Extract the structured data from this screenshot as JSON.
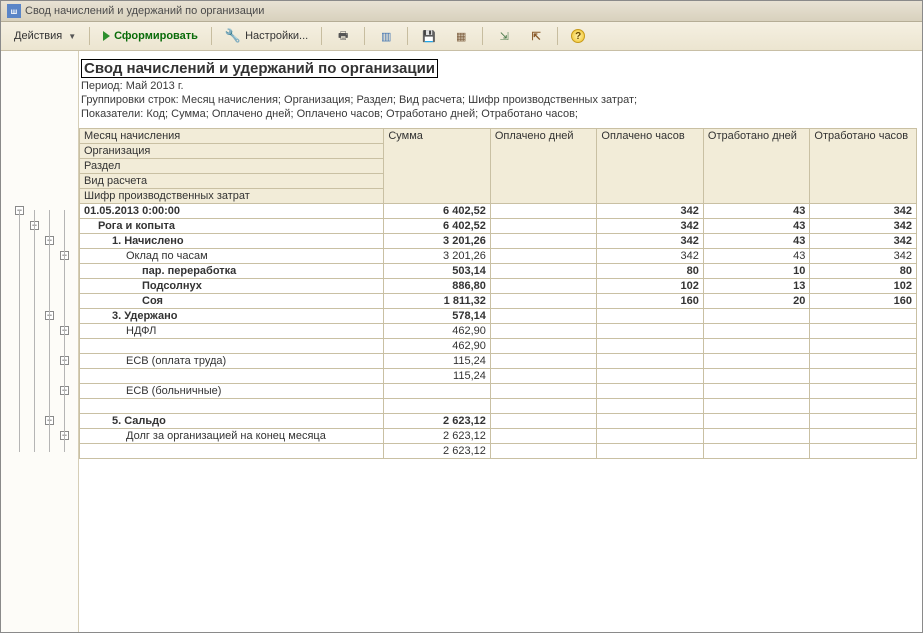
{
  "window": {
    "title": "Свод начислений и удержаний по организации"
  },
  "toolbar": {
    "actions_label": "Действия",
    "form_label": "Сформировать",
    "settings_label": "Настройки..."
  },
  "report": {
    "title": "Свод начислений и удержаний по организации",
    "period_line": "Период: Май 2013 г.",
    "grouping_line": "Группировки строк: Месяц начисления; Организация; Раздел; Вид расчета; Шифр производственных затрат;",
    "indicators_line": "Показатели: Код; Сумма; Оплачено дней; Оплачено часов; Отработано дней; Отработано часов;"
  },
  "headers": {
    "row1": "Месяц начисления",
    "row2": "Организация",
    "row3": "Раздел",
    "row4": "Вид расчета",
    "row5": "Шифр производственных затрат",
    "col_sum": "Сумма",
    "col_paid_days": "Оплачено дней",
    "col_paid_hours": "Оплачено часов",
    "col_worked_days": "Отработано дней",
    "col_worked_hours": "Отработано часов"
  },
  "rows": [
    {
      "label": "01.05.2013 0:00:00",
      "indent": 0,
      "bold": true,
      "sum": "6 402,52",
      "pd": "",
      "ph": "342",
      "wd": "43",
      "wh": "342"
    },
    {
      "label": "Рога и копыта",
      "indent": 1,
      "bold": true,
      "sum": "6 402,52",
      "pd": "",
      "ph": "342",
      "wd": "43",
      "wh": "342"
    },
    {
      "label": "1. Начислено",
      "indent": 2,
      "bold": true,
      "sum": "3 201,26",
      "pd": "",
      "ph": "342",
      "wd": "43",
      "wh": "342"
    },
    {
      "label": "Оклад по часам",
      "indent": 3,
      "bold": false,
      "sum": "3 201,26",
      "pd": "",
      "ph": "342",
      "wd": "43",
      "wh": "342"
    },
    {
      "label": "пар. переработка",
      "indent": 4,
      "bold": true,
      "sum": "503,14",
      "pd": "",
      "ph": "80",
      "wd": "10",
      "wh": "80"
    },
    {
      "label": "Подсолнух",
      "indent": 4,
      "bold": true,
      "sum": "886,80",
      "pd": "",
      "ph": "102",
      "wd": "13",
      "wh": "102"
    },
    {
      "label": "Соя",
      "indent": 4,
      "bold": true,
      "sum": "1 811,32",
      "pd": "",
      "ph": "160",
      "wd": "20",
      "wh": "160"
    },
    {
      "label": "3. Удержано",
      "indent": 2,
      "bold": true,
      "sum": "578,14",
      "pd": "",
      "ph": "",
      "wd": "",
      "wh": ""
    },
    {
      "label": "НДФЛ",
      "indent": 3,
      "bold": false,
      "sum": "462,90",
      "pd": "",
      "ph": "",
      "wd": "",
      "wh": ""
    },
    {
      "label": "",
      "indent": 4,
      "bold": false,
      "sum": "462,90",
      "pd": "",
      "ph": "",
      "wd": "",
      "wh": ""
    },
    {
      "label": "ЕСВ (оплата труда)",
      "indent": 3,
      "bold": false,
      "sum": "115,24",
      "pd": "",
      "ph": "",
      "wd": "",
      "wh": ""
    },
    {
      "label": "",
      "indent": 4,
      "bold": false,
      "sum": "115,24",
      "pd": "",
      "ph": "",
      "wd": "",
      "wh": ""
    },
    {
      "label": "ЕСВ (больничные)",
      "indent": 3,
      "bold": false,
      "sum": "",
      "pd": "",
      "ph": "",
      "wd": "",
      "wh": ""
    },
    {
      "label": "",
      "indent": 4,
      "bold": false,
      "sum": "",
      "pd": "",
      "ph": "",
      "wd": "",
      "wh": ""
    },
    {
      "label": "5. Сальдо",
      "indent": 2,
      "bold": true,
      "sum": "2 623,12",
      "pd": "",
      "ph": "",
      "wd": "",
      "wh": ""
    },
    {
      "label": "Долг за организацией на конец месяца",
      "indent": 3,
      "bold": false,
      "sum": "2 623,12",
      "pd": "",
      "ph": "",
      "wd": "",
      "wh": ""
    },
    {
      "label": "",
      "indent": 4,
      "bold": false,
      "sum": "2 623,12",
      "pd": "",
      "ph": "",
      "wd": "",
      "wh": ""
    }
  ]
}
